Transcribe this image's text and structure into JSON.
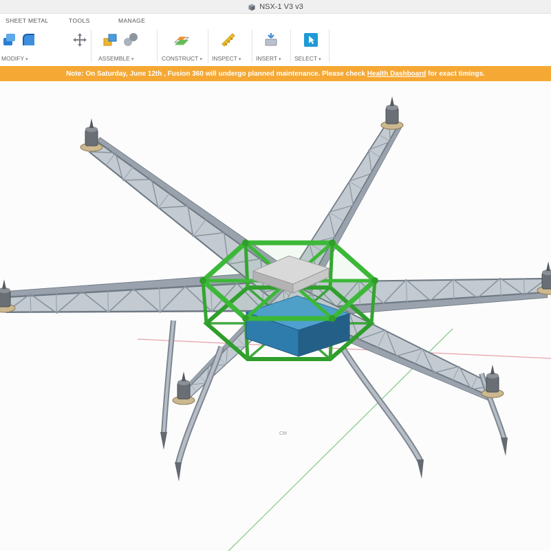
{
  "app": {
    "title": "NSX-1 V3 v3",
    "caret": "▾",
    "tabs": [
      {
        "label": "SHEET METAL"
      },
      {
        "label": "TOOLS"
      },
      {
        "label": "MANAGE"
      }
    ],
    "toolbar_groups": [
      {
        "label": "MODIFY"
      },
      {
        "label": "ASSEMBLE"
      },
      {
        "label": "CONSTRUCT"
      },
      {
        "label": "INSPECT"
      },
      {
        "label": "INSERT"
      },
      {
        "label": "SELECT"
      }
    ],
    "banner": {
      "text_before_link": "Note: On Saturday, June 12th , Fusion 360 will undergo planned maintenance. Please check ",
      "link_text": "Health Dashboard",
      "text_after_link": " for exact timings."
    }
  },
  "viewport": {
    "origin_label": "CM",
    "colors": {
      "banner_orange": "#f5a833",
      "frame_green": "#3cb838",
      "battery_blue": "#2e7cab",
      "truss_gray": "#c3cad1",
      "motor_mount_tan": "#cdb88f",
      "axis_green": "#90cf90",
      "axis_red": "#e8a0a8",
      "background": "#fcfcfc"
    }
  },
  "icons": {
    "document-cube-icon": "cube",
    "press-pull-icon": "blue 3d box",
    "fillet-icon": "blue rounded corner",
    "move-icon": "cross arrows ✥",
    "new-component-icon": "yellow and blue boxes",
    "joint-icon": "two gray spheres",
    "plane-icon": "construction plane",
    "measure-icon": "yellow caliper",
    "insert-icon": "arrow into box",
    "select-icon": "cursor in teal box",
    "dropdown-caret": "▾"
  }
}
